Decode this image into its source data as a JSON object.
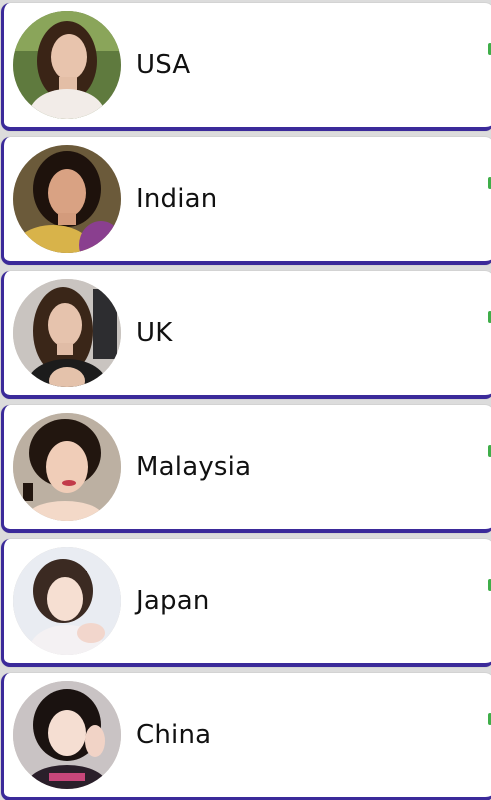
{
  "colors": {
    "card_background": "#ffffff",
    "card_accent_border": "#3b2a9a",
    "online_indicator": "#3fae49",
    "page_background": "#dcdcdc"
  },
  "countries": [
    {
      "label": "USA",
      "avatar_icon": "profile-photo"
    },
    {
      "label": "Indian",
      "avatar_icon": "profile-photo"
    },
    {
      "label": "UK",
      "avatar_icon": "profile-photo"
    },
    {
      "label": "Malaysia",
      "avatar_icon": "profile-photo"
    },
    {
      "label": "Japan",
      "avatar_icon": "profile-photo"
    },
    {
      "label": "China",
      "avatar_icon": "profile-photo"
    }
  ]
}
